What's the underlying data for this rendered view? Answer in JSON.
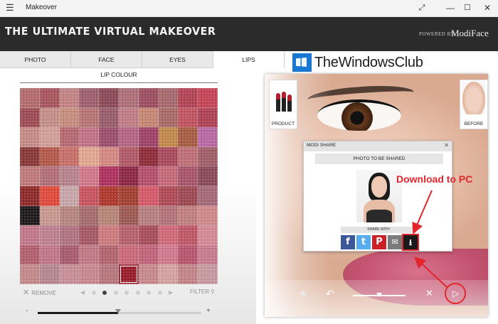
{
  "window": {
    "title": "Makeover",
    "menu_icon": "hamburger-icon",
    "restore_icon": "resize-icon",
    "minimize_icon": "minimize-icon",
    "maximize_icon": "maximize-icon",
    "close_icon": "close-icon"
  },
  "banner": {
    "title": "THE ULTIMATE VIRTUAL MAKEOVER",
    "powered_by": "POWERED BY",
    "brand": "ModiFace"
  },
  "tabs": [
    {
      "label": "PHOTO",
      "active": false
    },
    {
      "label": "FACE",
      "active": false
    },
    {
      "label": "EYES",
      "active": false
    },
    {
      "label": "LIPS",
      "active": true
    }
  ],
  "watermark": {
    "text": "TheWindowsClub"
  },
  "lip_panel": {
    "section_title": "LIP COLOUR",
    "remove_label": "REMOVE",
    "filter_label": "FILTER",
    "pager_pages": 7,
    "pager_active_index": 1,
    "intensity_min_label": "-",
    "intensity_max_label": "+",
    "intensity_value": 0.49,
    "selected_swatch_index": 95,
    "swatch_colors": [
      "#b56c6f",
      "#a9565f",
      "#c48486",
      "#a06070",
      "#8d4a57",
      "#b0707a",
      "#9e4f60",
      "#a86a6e",
      "#b34455",
      "#c64657",
      "#a04c56",
      "#c59088",
      "#c88d80",
      "#b87573",
      "#9a5d6b",
      "#c27d86",
      "#c88775",
      "#aa6b66",
      "#c25560",
      "#b04255",
      "#c88b86",
      "#d49f98",
      "#b86a72",
      "#c37386",
      "#9c4f6e",
      "#b46683",
      "#a1436a",
      "#c3894d",
      "#a85d44",
      "#ba6aa5",
      "#8a3838",
      "#b45a4b",
      "#c8706a",
      "#e3a890",
      "#d48a82",
      "#b25a68",
      "#8f2d3b",
      "#aa4a5e",
      "#c06f78",
      "#a25f6a",
      "#c07a7c",
      "#b4707a",
      "#b8848f",
      "#d27a8c",
      "#b0325e",
      "#8e2848",
      "#b6506e",
      "#c66a7a",
      "#a9556a",
      "#8c4a58",
      "#8f2a2a",
      "#e24b3c",
      "#c8a8aa",
      "#c85460",
      "#b0382e",
      "#a44032",
      "#d65a6a",
      "#b04a56",
      "#9e4a54",
      "#a66a7a",
      "#1e1a1c",
      "#c99a90",
      "#b78680",
      "#a66c6e",
      "#b88678",
      "#9e5a52",
      "#b88080",
      "#b5737a",
      "#c28080",
      "#d08a8a",
      "#c27a8a",
      "#be8290",
      "#b37482",
      "#a65a66",
      "#cf7b7e",
      "#b8626e",
      "#a94e5c",
      "#d26a7a",
      "#c05868",
      "#d58a98",
      "#b46070",
      "#c27888",
      "#a95c6e",
      "#c17a86",
      "#b4656f",
      "#cc6a7a",
      "#c2647a",
      "#d27a8e",
      "#b8566e",
      "#c97c8c",
      "#c58a8c",
      "#b88890",
      "#c99098",
      "#ca8990",
      "#b8787e",
      "#9a1e2c",
      "#c88a8e",
      "#d7a2a2",
      "#c4868a",
      "#c99aa0"
    ]
  },
  "preview": {
    "product_label": "PRODUCT",
    "before_label": "BEFORE",
    "product_icon": "lipstick-icon",
    "zoom_value": 0.5
  },
  "share_modal": {
    "title": "MODI SHARE",
    "photo_label": "PHOTO TO BE SHARED",
    "share_with_label": "SHARE WITH",
    "close_glyph": "✕",
    "services": [
      "facebook",
      "twitter",
      "pinterest",
      "email",
      "download"
    ]
  },
  "annotation": {
    "text": "Download to PC",
    "color": "#e2262b"
  }
}
